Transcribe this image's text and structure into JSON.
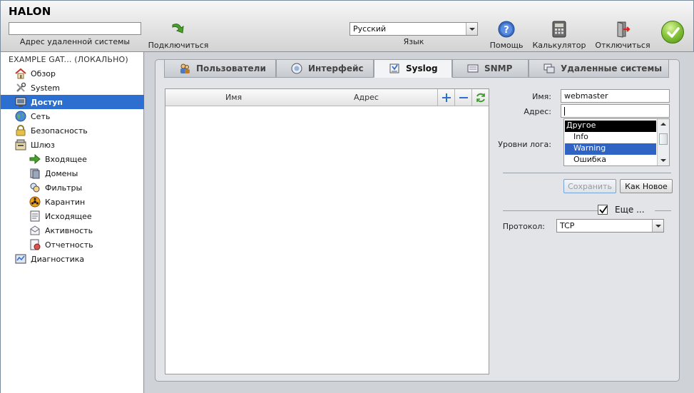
{
  "app": {
    "logo": "HALON"
  },
  "toolbar": {
    "remote_address_value": "",
    "remote_address_label": "Адрес удаленной системы",
    "connect_label": "Подключиться",
    "language_value": "Русский",
    "language_label": "Язык",
    "help_label": "Помощь",
    "calculator_label": "Калькулятор",
    "disconnect_label": "Отключиться"
  },
  "sidebar": {
    "title": "EXAMPLE GAT... (ЛОКАЛЬНО)",
    "items": [
      {
        "label": "Обзор",
        "icon": "home-icon"
      },
      {
        "label": "System",
        "icon": "tools-icon"
      },
      {
        "label": "Доступ",
        "icon": "monitor-icon",
        "active": true
      },
      {
        "label": "Сеть",
        "icon": "globe-icon"
      },
      {
        "label": "Безопасность",
        "icon": "lock-icon"
      },
      {
        "label": "Шлюз",
        "icon": "gateway-icon"
      },
      {
        "label": "Входящее",
        "icon": "arrow-right-icon"
      },
      {
        "label": "Домены",
        "icon": "domains-icon"
      },
      {
        "label": "Фильтры",
        "icon": "filter-icon"
      },
      {
        "label": "Карантин",
        "icon": "biohazard-icon"
      },
      {
        "label": "Исходящее",
        "icon": "outbox-icon"
      },
      {
        "label": "Активность",
        "icon": "activity-icon"
      },
      {
        "label": "Отчетность",
        "icon": "report-icon"
      },
      {
        "label": "Диагностика",
        "icon": "diagnostics-icon"
      }
    ]
  },
  "tabs": [
    {
      "label": "Пользователи",
      "icon": "users-icon"
    },
    {
      "label": "Интерфейс",
      "icon": "interface-icon"
    },
    {
      "label": "Syslog",
      "icon": "syslog-icon",
      "active": true
    },
    {
      "label": "SNMP",
      "icon": "snmp-icon"
    },
    {
      "label": "Удаленные системы",
      "icon": "remote-systems-icon"
    }
  ],
  "list": {
    "columns": [
      "Имя",
      "Адрес"
    ],
    "rows": []
  },
  "form": {
    "name_label": "Имя:",
    "name_value": "webmaster",
    "address_label": "Адрес:",
    "address_value": "",
    "log_levels_label": "Уровни лога:",
    "log_levels": {
      "header": "Другое",
      "options": [
        "Info",
        "Warning",
        "Ошибка"
      ],
      "selected": "Warning"
    },
    "save_label": "Сохранить",
    "save_as_new_label": "Как Новое",
    "more_label": "Еще ...",
    "more_checked": true,
    "protocol_label": "Протокол:",
    "protocol_value": "TCP"
  },
  "colors": {
    "sidebar_active": "#2c6fd1",
    "selection": "#2f64c4",
    "ok_green": "#8cc63f"
  }
}
